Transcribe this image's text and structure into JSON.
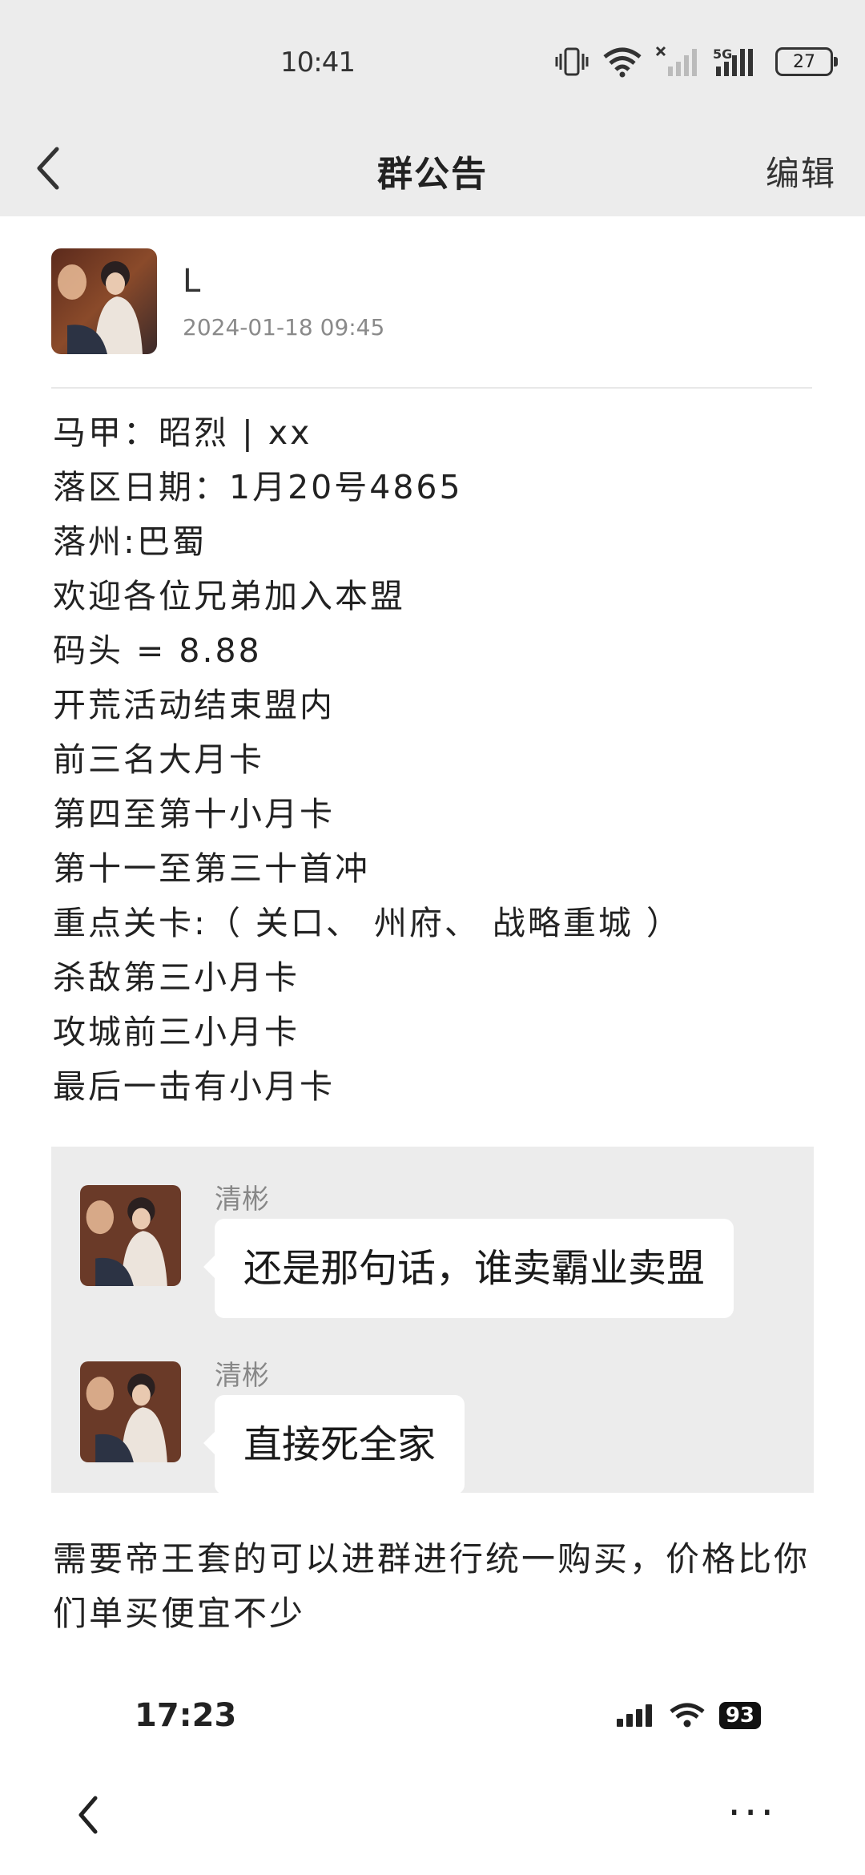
{
  "status_bar": {
    "time": "10:41",
    "battery": "27",
    "network": "5G"
  },
  "nav": {
    "title": "群公告",
    "edit": "编辑"
  },
  "post": {
    "author": "L",
    "date": "2024-01-18 09:45"
  },
  "announcement_lines": [
    "马甲：昭烈 | xx",
    "落区日期：1月20号4865",
    "落州:巴蜀",
    "欢迎各位兄弟加入本盟",
    "码头 = 8.88",
    "开荒活动结束盟内",
    "前三名大月卡",
    "第四至第十小月卡",
    "第十一至第三十首冲",
    "重点关卡:（ 关口、 州府、 战略重城 ）",
    "杀敌第三小月卡",
    "攻城前三小月卡",
    "最后一击有小月卡"
  ],
  "chat": [
    {
      "name": "清彬",
      "message": "还是那句话，谁卖霸业卖盟"
    },
    {
      "name": "清彬",
      "message": "直接死全家"
    }
  ],
  "footer_text": "需要帝王套的可以进群进行统一购买，价格比你们单买便宜不少",
  "inner_status": {
    "time": "17:23",
    "battery": "93"
  },
  "bottom_nav": {
    "more": "···"
  }
}
